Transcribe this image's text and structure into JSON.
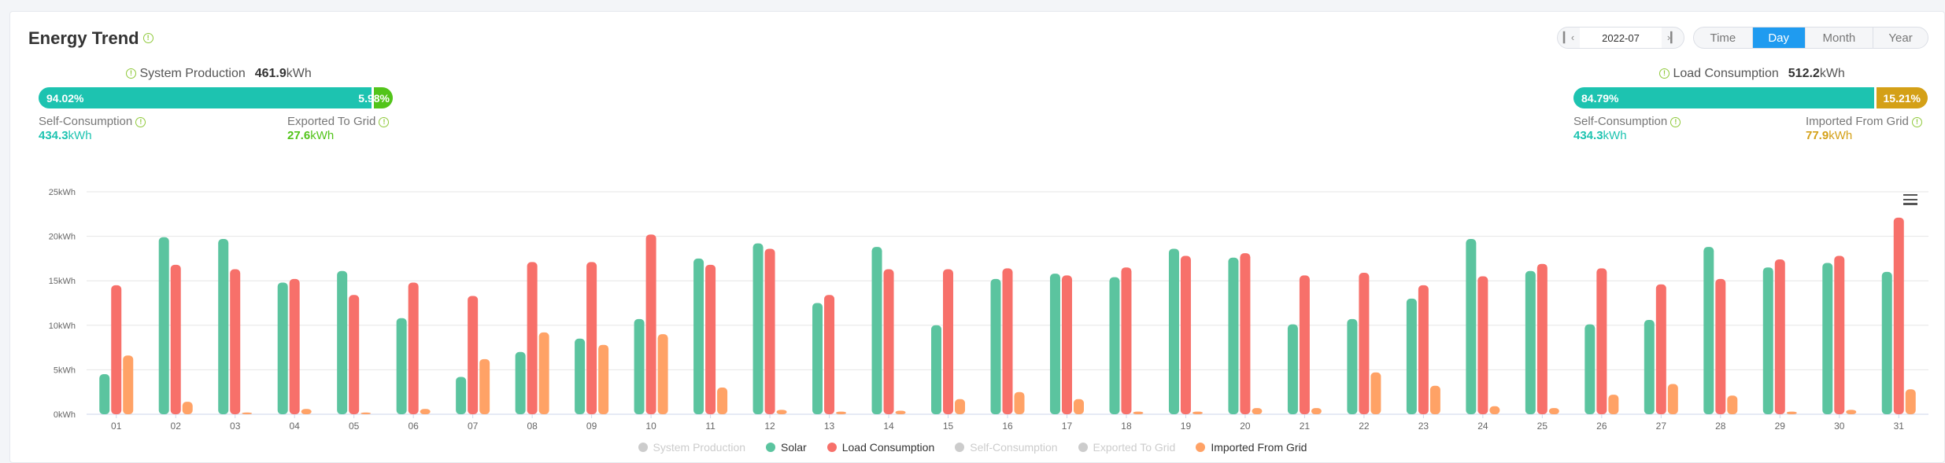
{
  "header": {
    "title": "Energy Trend"
  },
  "controls": {
    "date": "2022-07",
    "prev_icon": "first-page-icon",
    "next_icon": "last-page-icon",
    "tabs": [
      {
        "label": "Time",
        "active": false
      },
      {
        "label": "Day",
        "active": true
      },
      {
        "label": "Month",
        "active": false
      },
      {
        "label": "Year",
        "active": false
      }
    ]
  },
  "production": {
    "label": "System Production",
    "value": "461.9",
    "unit": "kWh",
    "bar": {
      "self_pct_label": "94.02%",
      "export_pct_label": "5.98%",
      "self_fraction": 0.9402,
      "export_fraction": 0.0598
    },
    "self_label": "Self-Consumption",
    "self_value": "434.3",
    "self_unit": "kWh",
    "export_label": "Exported To Grid",
    "export_value": "27.6",
    "export_unit": "kWh"
  },
  "consumption": {
    "label": "Load Consumption",
    "value": "512.2",
    "unit": "kWh",
    "bar": {
      "self_pct_label": "84.79%",
      "import_pct_label": "15.21%",
      "self_fraction": 0.8479,
      "import_fraction": 0.1521
    },
    "self_label": "Self-Consumption",
    "self_value": "434.3",
    "self_unit": "kWh",
    "import_label": "Imported From Grid",
    "import_value": "77.9",
    "import_unit": "kWh"
  },
  "colors": {
    "solar": "#5bc49f",
    "load": "#f7706a",
    "import": "#ffa266",
    "self_bar": "#1dc3b0",
    "export_bar": "#52c41a",
    "import_bar": "#d4a017",
    "inactive": "#cccccc"
  },
  "chart_data": {
    "type": "bar",
    "categories": [
      "01",
      "02",
      "03",
      "04",
      "05",
      "06",
      "07",
      "08",
      "09",
      "10",
      "11",
      "12",
      "13",
      "14",
      "15",
      "16",
      "17",
      "18",
      "19",
      "20",
      "21",
      "22",
      "23",
      "24",
      "25",
      "26",
      "27",
      "28",
      "29",
      "30",
      "31"
    ],
    "y_unit": "kWh",
    "ylim": [
      0,
      25
    ],
    "y_ticks": [
      "0kWh",
      "5kWh",
      "10kWh",
      "15kWh",
      "20kWh",
      "25kWh"
    ],
    "grid": true,
    "legend_position": "bottom",
    "legend": [
      {
        "name": "System Production",
        "active": false
      },
      {
        "name": "Solar",
        "active": true
      },
      {
        "name": "Load Consumption",
        "active": true
      },
      {
        "name": "Self-Consumption",
        "active": false
      },
      {
        "name": "Exported To Grid",
        "active": false
      },
      {
        "name": "Imported From Grid",
        "active": true
      }
    ],
    "series": [
      {
        "name": "Solar",
        "values": [
          4.5,
          19.9,
          19.7,
          14.8,
          16.1,
          10.8,
          4.2,
          7.0,
          8.5,
          10.7,
          17.5,
          19.2,
          12.5,
          18.8,
          10.0,
          15.2,
          15.8,
          15.4,
          18.6,
          17.6,
          10.1,
          10.7,
          13.0,
          19.7,
          16.1,
          10.1,
          10.6,
          18.8,
          16.5,
          17.0,
          16.0
        ]
      },
      {
        "name": "Load Consumption",
        "values": [
          14.5,
          16.8,
          16.3,
          15.2,
          13.4,
          14.8,
          13.3,
          17.1,
          17.1,
          20.2,
          16.8,
          18.6,
          13.4,
          16.3,
          16.3,
          16.4,
          15.6,
          16.5,
          17.8,
          18.1,
          15.6,
          15.9,
          14.5,
          15.5,
          16.9,
          16.4,
          14.6,
          15.2,
          17.4,
          17.8,
          22.1
        ]
      },
      {
        "name": "Imported From Grid",
        "values": [
          6.6,
          1.4,
          0.2,
          0.6,
          0.2,
          0.6,
          6.2,
          9.2,
          7.8,
          9.0,
          3.0,
          0.5,
          0.3,
          0.4,
          1.7,
          2.5,
          1.7,
          0.3,
          0.3,
          0.7,
          0.7,
          4.7,
          3.2,
          0.9,
          0.7,
          2.2,
          3.4,
          2.1,
          0.3,
          0.5,
          2.8
        ]
      }
    ]
  }
}
